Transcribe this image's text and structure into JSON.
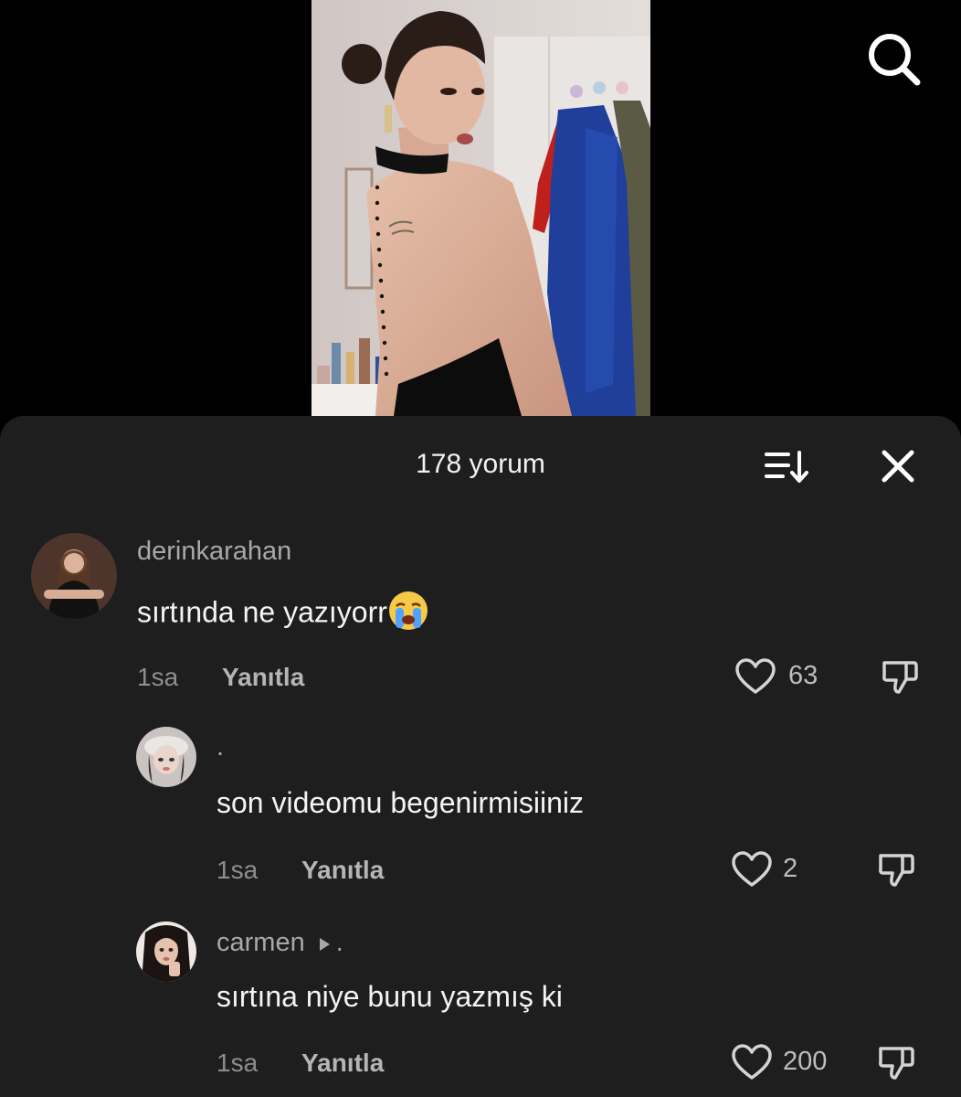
{
  "video": {
    "icon": "search-icon"
  },
  "comments_header": {
    "count_label": "178 yorum",
    "sort_icon": "sort-icon",
    "close_icon": "close-icon"
  },
  "comments": [
    {
      "username": "derinkarahan",
      "text": "sırtında ne yazıyorr",
      "emoji": "loudly-crying-face",
      "time": "1sa",
      "reply_label": "Yanıtla",
      "likes": "63"
    },
    {
      "username": ".",
      "text": "son videomu begenirmisiiniz",
      "time": "1sa",
      "reply_label": "Yanıtla",
      "likes": "2"
    },
    {
      "username": "carmen",
      "reply_to": ".",
      "text": "sırtına niye bunu yazmış ki",
      "time": "1sa",
      "reply_label": "Yanıtla",
      "likes": "200"
    }
  ],
  "colors": {
    "sheet_bg": "#1e1e1e",
    "page_bg": "#000000",
    "muted_text": "#8e8e8e"
  }
}
